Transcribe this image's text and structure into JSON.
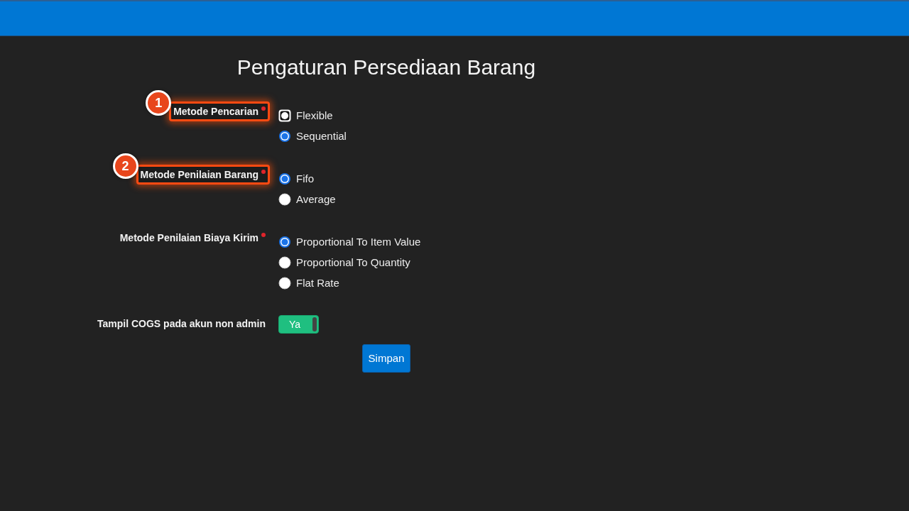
{
  "page_title": "Pengaturan Persediaan Barang",
  "fields": [
    {
      "kind": "radio",
      "label": "Metode Pencarian",
      "required": true,
      "callout": "1",
      "options": [
        {
          "label": "Flexible",
          "selected": false,
          "focused": true
        },
        {
          "label": "Sequential",
          "selected": true,
          "focused": false
        }
      ]
    },
    {
      "kind": "radio",
      "label": "Metode Penilaian Barang",
      "required": true,
      "callout": "2",
      "options": [
        {
          "label": "Fifo",
          "selected": true,
          "focused": false
        },
        {
          "label": "Average",
          "selected": false,
          "focused": false
        }
      ]
    },
    {
      "kind": "radio",
      "label": "Metode Penilaian Biaya Kirim",
      "required": true,
      "options": [
        {
          "label": "Proportional To Item Value",
          "selected": true,
          "focused": false
        },
        {
          "label": "Proportional To Quantity",
          "selected": false,
          "focused": false
        },
        {
          "label": "Flat Rate",
          "selected": false,
          "focused": false
        }
      ]
    },
    {
      "kind": "toggle",
      "label": "Tampil COGS pada akun non admin",
      "required": false,
      "toggle": {
        "text": "Ya",
        "on": true
      }
    }
  ],
  "save_button": "Simpan"
}
